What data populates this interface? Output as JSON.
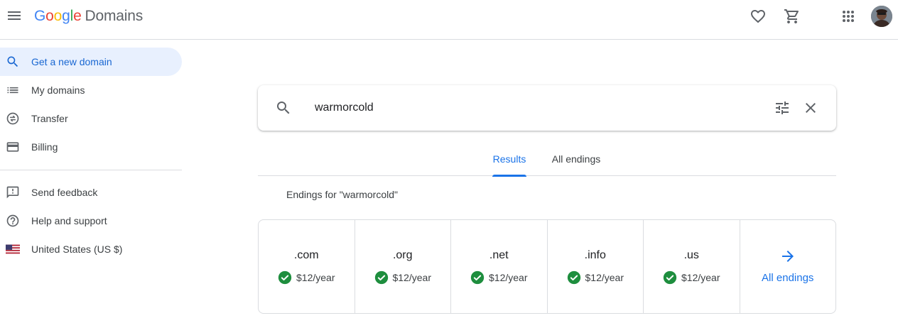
{
  "app": {
    "logo_letters": [
      "G",
      "o",
      "o",
      "g",
      "l",
      "e"
    ],
    "product": "Domains"
  },
  "colors": {
    "accent": "#1a73e8",
    "active_bg": "#e8f0fe",
    "success": "#1e8e3e"
  },
  "header": {
    "icons": [
      "menu-icon",
      "favorite-icon",
      "cart-icon",
      "apps-icon",
      "account-avatar"
    ]
  },
  "sidebar": {
    "items": [
      {
        "label": "Get a new domain",
        "icon": "search-icon",
        "active": true
      },
      {
        "label": "My domains",
        "icon": "list-icon"
      },
      {
        "label": "Transfer",
        "icon": "transfer-icon"
      },
      {
        "label": "Billing",
        "icon": "credit-card-icon"
      },
      {
        "label": "Send feedback",
        "icon": "feedback-icon"
      },
      {
        "label": "Help and support",
        "icon": "help-icon"
      },
      {
        "label": "United States (US $)",
        "icon": "us-flag-icon"
      }
    ]
  },
  "search": {
    "value": "warmorcold"
  },
  "tabs": [
    {
      "label": "Results",
      "active": true
    },
    {
      "label": "All endings"
    }
  ],
  "endings": {
    "title": "Endings for \"warmorcold\"",
    "cards": [
      {
        "tld": ".com",
        "price": "$12/year",
        "available": true
      },
      {
        "tld": ".org",
        "price": "$12/year",
        "available": true
      },
      {
        "tld": ".net",
        "price": "$12/year",
        "available": true
      },
      {
        "tld": ".info",
        "price": "$12/year",
        "available": true
      },
      {
        "tld": ".us",
        "price": "$12/year",
        "available": true
      }
    ],
    "all_label": "All endings"
  }
}
